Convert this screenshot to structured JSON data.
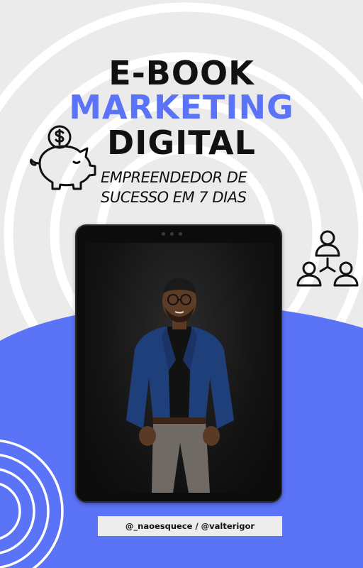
{
  "title": {
    "line1": "E-BOOK",
    "line2": "MARKETING",
    "line3": "DIGITAL"
  },
  "subtitle": {
    "line1": "EMPREENDEDOR DE",
    "line2": "SUCESSO EM 7 DIAS"
  },
  "footer": {
    "handles": "@_naoesquece / @valterigor"
  },
  "icons": {
    "piggy": "piggy-bank-dollar-icon",
    "people": "team-network-icon"
  },
  "colors": {
    "background": "#ebebeb",
    "accent_blue": "#5b73f6",
    "text_dark": "#111111",
    "rings": "#ffffff"
  }
}
